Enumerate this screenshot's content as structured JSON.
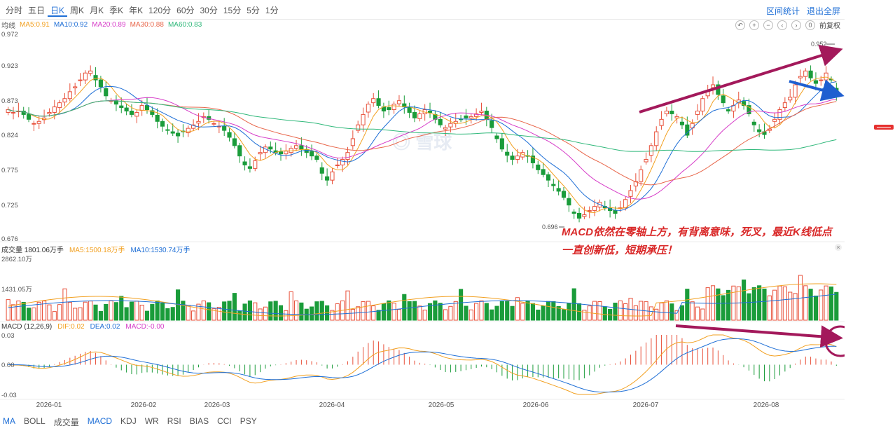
{
  "period_tabs": [
    "分时",
    "五日",
    "日K",
    "周K",
    "月K",
    "季K",
    "年K",
    "120分",
    "60分",
    "30分",
    "15分",
    "5分",
    "1分"
  ],
  "active_period": "日K",
  "top_links": [
    "区间统计",
    "退出全屏"
  ],
  "ma_legend": {
    "label": "均线",
    "items": [
      {
        "text": "MA5:0.91",
        "color": "#f2a020"
      },
      {
        "text": "MA10:0.92",
        "color": "#1f6fd6"
      },
      {
        "text": "MA20:0.89",
        "color": "#d63cc8"
      },
      {
        "text": "MA30:0.88",
        "color": "#e8664a"
      },
      {
        "text": "MA60:0.83",
        "color": "#2fb87a"
      }
    ]
  },
  "controls": {
    "restore_label": "前复权"
  },
  "price_axis": [
    "0.972",
    "0.923",
    "0.873",
    "0.824",
    "0.775",
    "0.725",
    "0.676"
  ],
  "price_marks": {
    "high": "0.952",
    "low": "0.696"
  },
  "volume_legend": {
    "title": "成交量 1801.06万手",
    "ma5": "MA5:1500.18万手",
    "ma10": "MA10:1530.74万手",
    "ma5_color": "#f2a020",
    "ma10_color": "#1f6fd6"
  },
  "volume_axis": [
    "2862.10万",
    "1431.05万"
  ],
  "macd_legend": {
    "title": "MACD (12,26,9)",
    "dif": "DIF:0.02",
    "dea": "DEA:0.02",
    "macd": "MACD:-0.00",
    "dif_color": "#f2a020",
    "dea_color": "#1f6fd6",
    "macd_color": "#d63cc8"
  },
  "macd_axis": [
    "0.03",
    "0.00",
    "-0.03"
  ],
  "x_labels": [
    "2026-01",
    "2026-02",
    "2026-03",
    "2026-04",
    "2026-05",
    "2026-06",
    "2026-07",
    "2026-08"
  ],
  "bottom_tabs": [
    "MA",
    "BOLL",
    "成交量",
    "MACD",
    "KDJ",
    "WR",
    "RSI",
    "BIAS",
    "CCI",
    "PSY"
  ],
  "active_bottom": [
    "MA",
    "MACD"
  ],
  "annotation": {
    "line1": "MACD依然在零轴上方，有背离意味，死叉，最近K线低点",
    "line2": "一直创新低，短期承压！"
  },
  "watermark": "雪球",
  "colors": {
    "up": "#e8503a",
    "down": "#1a9c3a",
    "annot_arrow": "#a3195b",
    "blue_arrow": "#1f5fd0"
  },
  "chart_data": {
    "type": "candlestick",
    "x_month_labels": [
      "2026-01",
      "2026-02",
      "2026-03",
      "2026-04",
      "2026-05",
      "2026-06",
      "2026-07",
      "2026-08"
    ],
    "close": [
      0.862,
      0.858,
      0.86,
      0.855,
      0.848,
      0.842,
      0.845,
      0.85,
      0.858,
      0.866,
      0.872,
      0.878,
      0.888,
      0.895,
      0.905,
      0.915,
      0.918,
      0.905,
      0.895,
      0.882,
      0.875,
      0.87,
      0.865,
      0.86,
      0.855,
      0.858,
      0.868,
      0.862,
      0.855,
      0.845,
      0.838,
      0.832,
      0.828,
      0.824,
      0.83,
      0.835,
      0.84,
      0.845,
      0.852,
      0.848,
      0.842,
      0.838,
      0.832,
      0.822,
      0.81,
      0.795,
      0.782,
      0.777,
      0.788,
      0.8,
      0.808,
      0.805,
      0.8,
      0.798,
      0.802,
      0.806,
      0.81,
      0.805,
      0.8,
      0.795,
      0.79,
      0.77,
      0.76,
      0.772,
      0.782,
      0.79,
      0.8,
      0.82,
      0.84,
      0.855,
      0.87,
      0.878,
      0.868,
      0.86,
      0.862,
      0.87,
      0.875,
      0.866,
      0.858,
      0.85,
      0.856,
      0.862,
      0.858,
      0.848,
      0.84,
      0.836,
      0.842,
      0.845,
      0.848,
      0.85,
      0.852,
      0.856,
      0.86,
      0.848,
      0.836,
      0.82,
      0.805,
      0.796,
      0.79,
      0.795,
      0.8,
      0.795,
      0.785,
      0.775,
      0.768,
      0.76,
      0.752,
      0.744,
      0.735,
      0.724,
      0.712,
      0.705,
      0.71,
      0.716,
      0.722,
      0.728,
      0.72,
      0.716,
      0.712,
      0.72,
      0.732,
      0.745,
      0.758,
      0.775,
      0.79,
      0.81,
      0.83,
      0.848,
      0.86,
      0.856,
      0.852,
      0.84,
      0.825,
      0.842,
      0.86,
      0.878,
      0.89,
      0.898,
      0.884,
      0.872,
      0.86,
      0.868,
      0.876,
      0.868,
      0.856,
      0.84,
      0.83,
      0.826,
      0.834,
      0.848,
      0.862,
      0.872,
      0.88,
      0.898,
      0.91,
      0.918,
      0.908,
      0.9,
      0.905,
      0.915,
      0.905,
      0.885
    ],
    "high_price": 0.952,
    "low_price": 0.696,
    "ylim_price": [
      0.676,
      0.972
    ],
    "ylim_volume_wan": [
      0,
      2862.1
    ],
    "ylim_macd": [
      -0.03,
      0.03
    ]
  }
}
